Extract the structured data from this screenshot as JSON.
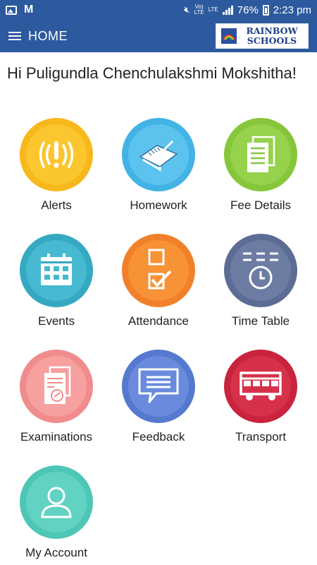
{
  "status_bar": {
    "network": "LTE",
    "network_alt": "LTE",
    "battery": "76%",
    "time": "2:23 pm",
    "gmail_glyph": "M"
  },
  "app_bar": {
    "title": "HOME",
    "logo_line1": "RAINBOW",
    "logo_line2": "SCHOOLS"
  },
  "greeting": "Hi  Puligundla Chenchulakshmi Mokshitha!",
  "tiles": [
    {
      "label": "Alerts",
      "icon": "alert-icon",
      "color": "#f7b81b",
      "inner": "#fbc62f"
    },
    {
      "label": "Homework",
      "icon": "homework-icon",
      "color": "#43b3e6",
      "inner": "#5cc3ef"
    },
    {
      "label": "Fee Details",
      "icon": "fee-document-icon",
      "color": "#86c63b",
      "inner": "#97d24d"
    },
    {
      "label": "Events",
      "icon": "calendar-icon",
      "color": "#35a9c2",
      "inner": "#47b9d0"
    },
    {
      "label": "Attendance",
      "icon": "checkbox-icon",
      "color": "#f0812a",
      "inner": "#f79236"
    },
    {
      "label": "Time Table",
      "icon": "clock-icon",
      "color": "#5d6c94",
      "inner": "#6d7ca3"
    },
    {
      "label": "Examinations",
      "icon": "exam-paper-icon",
      "color": "#f08c8c",
      "inner": "#f6a0a0"
    },
    {
      "label": "Feedback",
      "icon": "chat-bubble-icon",
      "color": "#5579cf",
      "inner": "#6a8bdd"
    },
    {
      "label": "Transport",
      "icon": "bus-icon",
      "color": "#c9233d",
      "inner": "#d6314a"
    },
    {
      "label": "My Account",
      "icon": "user-icon",
      "color": "#4dc6b6",
      "inner": "#62d3c3"
    }
  ]
}
